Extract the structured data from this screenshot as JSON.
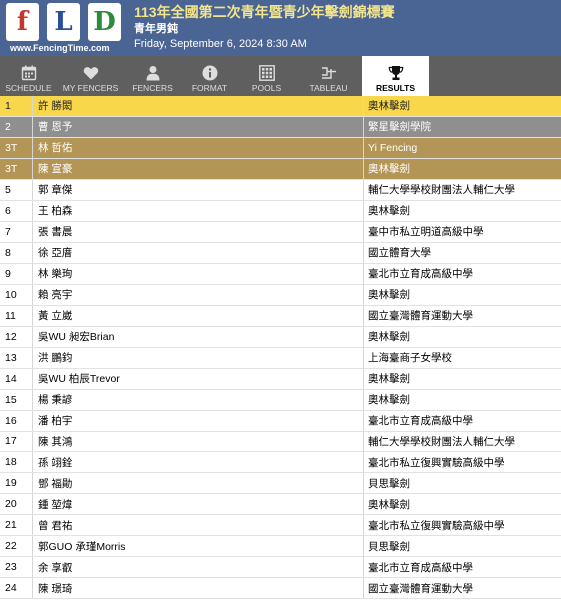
{
  "header": {
    "logo_letters": [
      "f",
      "L",
      "D"
    ],
    "logo_colors": [
      "#c0392b",
      "#2a4e9b",
      "#2e8b3a"
    ],
    "site": "www.FencingTime.com",
    "title": "113年全國第二次青年暨青少年擊劍錦標賽",
    "event": "青年男鈍",
    "date": "Friday, September 6, 2024 8:30 AM"
  },
  "tabs": [
    {
      "label": "SCHEDULE",
      "icon": "calendar-icon"
    },
    {
      "label": "MY FENCERS",
      "icon": "heart-icon"
    },
    {
      "label": "FENCERS",
      "icon": "person-icon"
    },
    {
      "label": "FORMAT",
      "icon": "info-icon"
    },
    {
      "label": "POOLS",
      "icon": "grid-icon"
    },
    {
      "label": "TABLEAU",
      "icon": "bracket-icon"
    },
    {
      "label": "RESULTS",
      "icon": "trophy-icon",
      "active": true
    }
  ],
  "colors": {
    "header_bg": "#4a6494",
    "tabs_bg": "#5f5f5f",
    "gold": "#f8d84a",
    "silver": "#8f8f8f",
    "bronze": "#b39556",
    "title": "#f2e58c"
  },
  "results": [
    {
      "place": "1",
      "name": "許 勝閎",
      "club": "奧林擊劍",
      "medal": "gold"
    },
    {
      "place": "2",
      "name": "曹 恩予",
      "club": "繁星擊劍學院",
      "medal": "silver"
    },
    {
      "place": "3T",
      "name": "林 哲佑",
      "club": "Yi Fencing",
      "medal": "bronze"
    },
    {
      "place": "3T",
      "name": "陳 宣豪",
      "club": "奧林擊劍",
      "medal": "bronze"
    },
    {
      "place": "5",
      "name": "郭 章傑",
      "club": "輔仁大學學校財團法人輔仁大學"
    },
    {
      "place": "6",
      "name": "王 柏森",
      "club": "奧林擊劍"
    },
    {
      "place": "7",
      "name": "張 書晨",
      "club": "臺中市私立明道高級中學"
    },
    {
      "place": "8",
      "name": "徐 亞庴",
      "club": "國立體育大學"
    },
    {
      "place": "9",
      "name": "林 樂珣",
      "club": "臺北市立育成高級中學"
    },
    {
      "place": "10",
      "name": "賴 亮宇",
      "club": "奧林擊劍"
    },
    {
      "place": "11",
      "name": "黃 立崴",
      "club": "國立臺灣體育運動大學"
    },
    {
      "place": "12",
      "name": "吳WU 昶宏Brian",
      "club": "奧林擊劍"
    },
    {
      "place": "13",
      "name": "洪 鵬鈞",
      "club": "上海臺商子女學校"
    },
    {
      "place": "14",
      "name": "吳WU 柏辰Trevor",
      "club": "奧林擊劍"
    },
    {
      "place": "15",
      "name": "楊 秉諺",
      "club": "奧林擊劍"
    },
    {
      "place": "16",
      "name": "潘 柏宇",
      "club": "臺北市立育成高級中學"
    },
    {
      "place": "17",
      "name": "陳 其鴻",
      "club": "輔仁大學學校財團法人輔仁大學"
    },
    {
      "place": "18",
      "name": "孫 翊銓",
      "club": "臺北市私立復興實驗高級中學"
    },
    {
      "place": "19",
      "name": "鄧 福勛",
      "club": "貝思擊劍"
    },
    {
      "place": "20",
      "name": "鍾 堃煒",
      "club": "奧林擊劍"
    },
    {
      "place": "21",
      "name": "曾 君祐",
      "club": "臺北市私立復興實驗高級中學"
    },
    {
      "place": "22",
      "name": "郭GUO 承瑾Morris",
      "club": "貝思擊劍"
    },
    {
      "place": "23",
      "name": "余 享叡",
      "club": "臺北市立育成高級中學"
    },
    {
      "place": "24",
      "name": "陳 璟琦",
      "club": "國立臺灣體育運動大學"
    }
  ]
}
